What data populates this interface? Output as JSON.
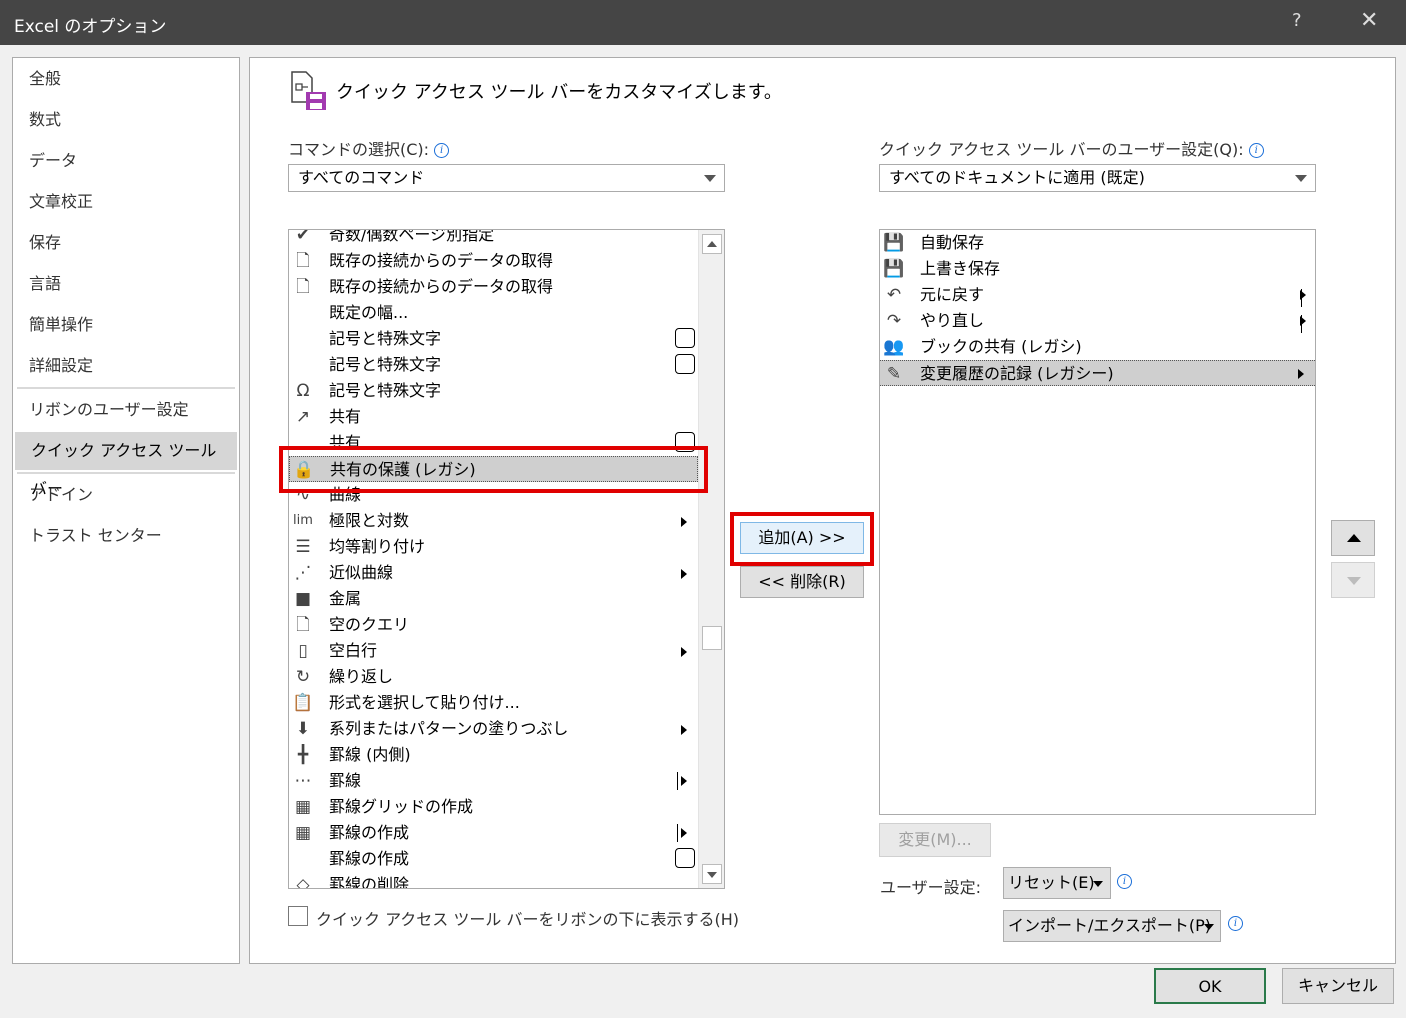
{
  "window": {
    "title": "Excel のオプション",
    "help": "?",
    "close": "✕"
  },
  "nav": {
    "items": [
      "全般",
      "数式",
      "データ",
      "文章校正",
      "保存",
      "言語",
      "簡単操作",
      "詳細設定",
      "リボンのユーザー設定",
      "クイック アクセス ツール バー",
      "アドイン",
      "トラスト センター"
    ]
  },
  "header": {
    "title": "クイック アクセス ツール バーをカスタマイズします。"
  },
  "left": {
    "label": "コマンドの選択(C):",
    "combo_value": "すべてのコマンド",
    "commands": [
      {
        "label": "奇数/偶数ページ別指定",
        "icon": "✔"
      },
      {
        "label": "既存の接続からのデータの取得",
        "icon": "🗋"
      },
      {
        "label": "既存の接続からのデータの取得",
        "icon": "🗋"
      },
      {
        "label": "既定の幅...",
        "icon": ""
      },
      {
        "label": "記号と特殊文字",
        "icon": ""
      },
      {
        "label": "記号と特殊文字",
        "icon": ""
      },
      {
        "label": "記号と特殊文字",
        "icon": "Ω"
      },
      {
        "label": "共有",
        "icon": "↗"
      },
      {
        "label": "共有",
        "icon": ""
      },
      {
        "label": "共有の保護 (レガシ)",
        "icon": "🔒"
      },
      {
        "label": "曲線",
        "icon": "∿"
      },
      {
        "label": "極限と対数",
        "icon": "lim"
      },
      {
        "label": "均等割り付け",
        "icon": "☰"
      },
      {
        "label": "近似曲線",
        "icon": "⋰"
      },
      {
        "label": "金属",
        "icon": "■"
      },
      {
        "label": "空のクエリ",
        "icon": "🗋"
      },
      {
        "label": "空白行",
        "icon": "▯"
      },
      {
        "label": "繰り返し",
        "icon": "↻"
      },
      {
        "label": "形式を選択して貼り付け...",
        "icon": "📋"
      },
      {
        "label": "系列またはパターンの塗りつぶし",
        "icon": "⬇"
      },
      {
        "label": "罫線 (内側)",
        "icon": "╋"
      },
      {
        "label": "罫線",
        "icon": "⋯"
      },
      {
        "label": "罫線グリッドの作成",
        "icon": "▦"
      },
      {
        "label": "罫線の作成",
        "icon": "▦"
      },
      {
        "label": "罫線の作成",
        "icon": ""
      },
      {
        "label": "罫線の削除",
        "icon": "◇"
      }
    ],
    "show_below": "クイック アクセス ツール バーをリボンの下に表示する(H)"
  },
  "middle": {
    "add": "追加(A) >>",
    "remove": "<< 削除(R)"
  },
  "right": {
    "label": "クイック アクセス ツール バーのユーザー設定(Q):",
    "combo_value": "すべてのドキュメントに適用 (既定)",
    "items": [
      {
        "label": "自動保存",
        "icon": "💾"
      },
      {
        "label": "上書き保存",
        "icon": "💾"
      },
      {
        "label": "元に戻す",
        "icon": "↶"
      },
      {
        "label": "やり直し",
        "icon": "↷"
      },
      {
        "label": "ブックの共有 (レガシ)",
        "icon": "👥"
      },
      {
        "label": "変更履歴の記録 (レガシー)",
        "icon": "✎"
      }
    ],
    "modify": "変更(M)...",
    "user_settings_label": "ユーザー設定:",
    "reset": "リセット(E)",
    "import_export": "インポート/エクスポート(P)"
  },
  "footer": {
    "ok": "OK",
    "cancel": "キャンセル"
  }
}
